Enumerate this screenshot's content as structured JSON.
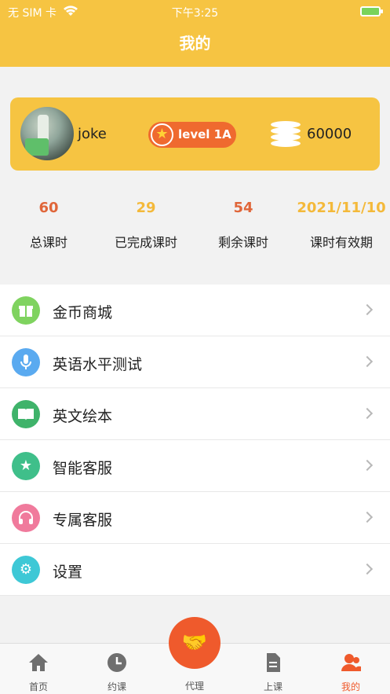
{
  "status_bar": {
    "carrier": "无 SIM 卡",
    "time": "下午3:25"
  },
  "header": {
    "title": "我的"
  },
  "profile": {
    "username": "joke",
    "level": "level 1A",
    "coins": "60000"
  },
  "stats": [
    {
      "value": "60",
      "label": "总课时",
      "color": "#e0663a"
    },
    {
      "value": "29",
      "label": "已完成课时",
      "color": "#f4b93a"
    },
    {
      "value": "54",
      "label": "剩余课时",
      "color": "#e0663a"
    },
    {
      "value": "2021/11/10",
      "label": "课时有效期",
      "color": "#f4b93a"
    }
  ],
  "menu": [
    {
      "label": "金币商城",
      "icon": "gift-icon",
      "color": "#7fd35f"
    },
    {
      "label": "英语水平测试",
      "icon": "microphone-icon",
      "color": "#5aaaf0"
    },
    {
      "label": "英文绘本",
      "icon": "book-icon",
      "color": "#3fb36a"
    },
    {
      "label": "智能客服",
      "icon": "star-icon",
      "color": "#3fbf8a"
    },
    {
      "label": "专属客服",
      "icon": "headphones-icon",
      "color": "#f07a9c"
    },
    {
      "label": "设置",
      "icon": "gear-icon",
      "color": "#3ec8d6"
    }
  ],
  "tab_bar": {
    "home": "首页",
    "book": "约课",
    "agent": "代理",
    "class": "上课",
    "mine": "我的"
  },
  "colors": {
    "brand_yellow": "#f6c442",
    "accent_orange": "#ef5a2c"
  }
}
